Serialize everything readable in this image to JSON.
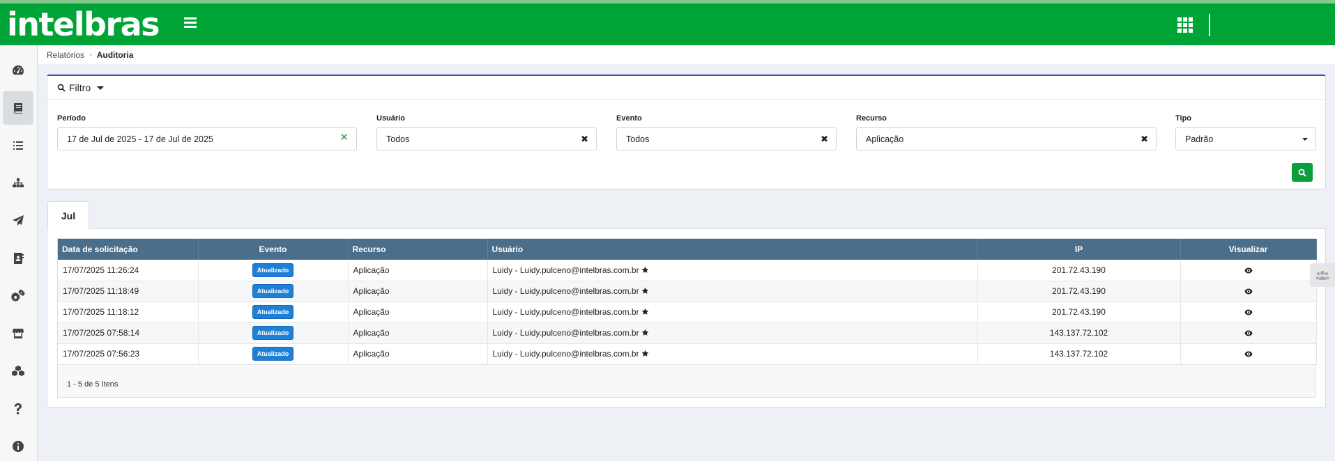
{
  "app": {
    "logo": "intelbras"
  },
  "breadcrumb": {
    "parent": "Relatórios",
    "current": "Auditoria"
  },
  "filter": {
    "title": "Filtro",
    "fields": {
      "periodo": {
        "label": "Período",
        "value": "17 de Jul de 2025 - 17 de Jul de 2025"
      },
      "usuario": {
        "label": "Usuário",
        "value": "Todos"
      },
      "evento": {
        "label": "Evento",
        "value": "Todos"
      },
      "recurso": {
        "label": "Recurso",
        "value": "Aplicação"
      },
      "tipo": {
        "label": "Tipo",
        "value": "Padrão"
      }
    }
  },
  "tabs": [
    {
      "label": "Jul",
      "active": true
    }
  ],
  "table": {
    "columns": [
      "Data de solicitação",
      "Evento",
      "Recurso",
      "Usuário",
      "IP",
      "Visualizar"
    ],
    "rows": [
      {
        "date": "17/07/2025 11:26:24",
        "event": "Atualizado",
        "resource": "Aplicação",
        "user": "Luidy - Luidy.pulceno@intelbras.com.br",
        "ip": "201.72.43.190"
      },
      {
        "date": "17/07/2025 11:18:49",
        "event": "Atualizado",
        "resource": "Aplicação",
        "user": "Luidy - Luidy.pulceno@intelbras.com.br",
        "ip": "201.72.43.190"
      },
      {
        "date": "17/07/2025 11:18:12",
        "event": "Atualizado",
        "resource": "Aplicação",
        "user": "Luidy - Luidy.pulceno@intelbras.com.br",
        "ip": "201.72.43.190"
      },
      {
        "date": "17/07/2025 07:58:14",
        "event": "Atualizado",
        "resource": "Aplicação",
        "user": "Luidy - Luidy.pulceno@intelbras.com.br",
        "ip": "143.137.72.102"
      },
      {
        "date": "17/07/2025 07:56:23",
        "event": "Atualizado",
        "resource": "Aplicação",
        "user": "Luidy - Luidy.pulceno@intelbras.com.br",
        "ip": "143.137.72.102"
      }
    ],
    "pager": "1 - 5 de 5 Itens"
  },
  "icons": {
    "sidebar": [
      "dashboard-icon",
      "book-icon",
      "list-icon",
      "sitemap-icon",
      "paper-plane-icon",
      "contact-card-icon",
      "gears-icon",
      "store-icon",
      "cubes-icon",
      "question-icon",
      "info-icon"
    ],
    "header": [
      "hamburger-icon",
      "apps-grid-icon"
    ]
  },
  "colors": {
    "header": "#00a335",
    "tableHeader": "#4b6f8a",
    "badge": "#1e7fd6",
    "searchButton": "#0a9f3a",
    "filterAccent": "#2a5aa8"
  }
}
